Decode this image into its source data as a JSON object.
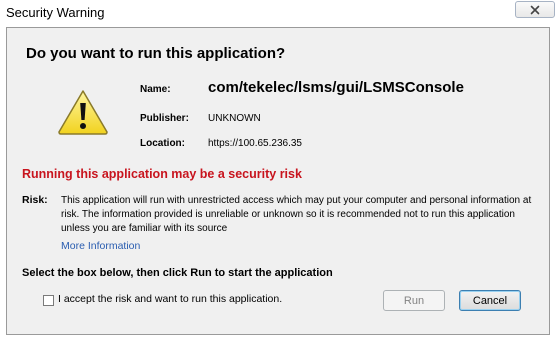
{
  "window": {
    "title": "Security Warning",
    "close_icon": "close-icon"
  },
  "dialog": {
    "question": "Do you want to run this application?",
    "icon": "warning-triangle-icon",
    "fields": {
      "name_label": "Name:",
      "name_value": "com/tekelec/lsms/gui/LSMSConsole",
      "publisher_label": "Publisher:",
      "publisher_value": "UNKNOWN",
      "location_label": "Location:",
      "location_value": "https://100.65.236.35"
    },
    "risk_heading": "Running this application may be a security risk",
    "risk_label": "Risk:",
    "risk_text": "This application will run with unrestricted access which may put your computer and personal information at risk. The information provided is unreliable or unknown so it is recommended not to run this application unless you are familiar with its source",
    "more_info_link": "More Information",
    "instruction": "Select the box below, then click Run to start the application",
    "accept_checkbox": {
      "label": "I accept the risk and want to run this application.",
      "checked": false
    },
    "buttons": {
      "run": "Run",
      "run_enabled": false,
      "cancel": "Cancel"
    }
  },
  "colors": {
    "risk_heading": "#c8141e",
    "link": "#2a5db0",
    "dialog_background": "#f0f0f0"
  }
}
